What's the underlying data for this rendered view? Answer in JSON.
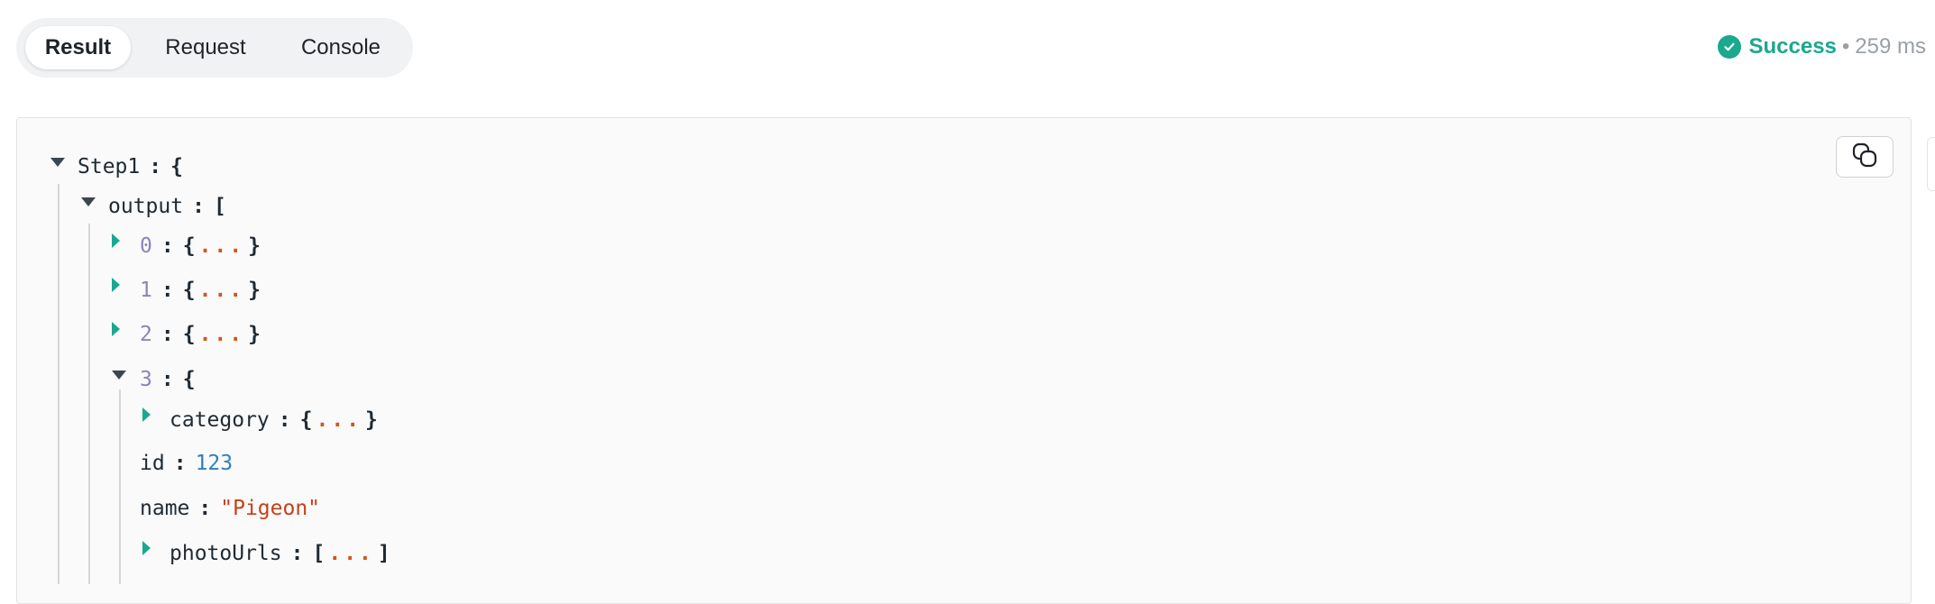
{
  "tabs": [
    {
      "label": "Result",
      "active": true
    },
    {
      "label": "Request",
      "active": false
    },
    {
      "label": "Console",
      "active": false
    }
  ],
  "status": {
    "text": "Success",
    "separator": "•",
    "duration": "259 ms",
    "color": "#1aa88e"
  },
  "tree": {
    "root_key": "Step1",
    "output_key": "output",
    "items": [
      {
        "index": "0",
        "collapsed_marker": "...",
        "open": "{",
        "close": "}"
      },
      {
        "index": "1",
        "collapsed_marker": "...",
        "open": "{",
        "close": "}"
      },
      {
        "index": "2",
        "collapsed_marker": "...",
        "open": "{",
        "close": "}"
      },
      {
        "index": "3",
        "open": "{"
      }
    ],
    "item3": {
      "category": {
        "key": "category",
        "collapsed_marker": "...",
        "open": "{",
        "close": "}"
      },
      "id": {
        "key": "id",
        "value": "123"
      },
      "name": {
        "key": "name",
        "value": "\"Pigeon\""
      },
      "photoUrls": {
        "key": "photoUrls",
        "collapsed_marker": "...",
        "open": "[",
        "close": "]"
      }
    },
    "colon": ":",
    "open_object": "{",
    "open_array": "["
  },
  "icons": {
    "status": "check-circle-icon",
    "copy": "copy-icon"
  }
}
